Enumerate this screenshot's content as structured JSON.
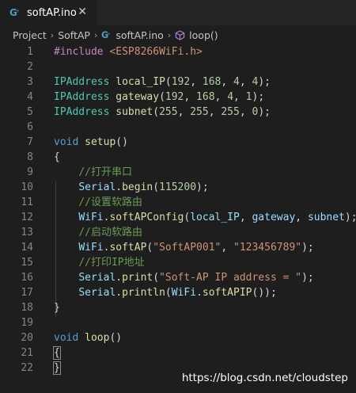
{
  "tab": {
    "filename": "softAP.ino",
    "close": "✕",
    "icon": "cpp-file-icon"
  },
  "breadcrumb": {
    "items": [
      "Project",
      "SoftAP",
      "softAP.ino",
      "loop()"
    ],
    "separator": "›"
  },
  "lines": [
    {
      "n": "1",
      "tokens": [
        [
          "#include ",
          "t-pre"
        ],
        [
          "<ESP8266WiFi.h>",
          "t-str"
        ]
      ]
    },
    {
      "n": "2",
      "tokens": []
    },
    {
      "n": "3",
      "tokens": [
        [
          "IPAddress ",
          "t-type"
        ],
        [
          "local_IP",
          "t-fn"
        ],
        [
          "(",
          "t-pun"
        ],
        [
          "192",
          "t-num"
        ],
        [
          ", ",
          "t-pun"
        ],
        [
          "168",
          "t-num"
        ],
        [
          ", ",
          "t-pun"
        ],
        [
          "4",
          "t-num"
        ],
        [
          ", ",
          "t-pun"
        ],
        [
          "4",
          "t-num"
        ],
        [
          ");",
          "t-pun"
        ]
      ]
    },
    {
      "n": "4",
      "tokens": [
        [
          "IPAddress ",
          "t-type"
        ],
        [
          "gateway",
          "t-fn"
        ],
        [
          "(",
          "t-pun"
        ],
        [
          "192",
          "t-num"
        ],
        [
          ", ",
          "t-pun"
        ],
        [
          "168",
          "t-num"
        ],
        [
          ", ",
          "t-pun"
        ],
        [
          "4",
          "t-num"
        ],
        [
          ", ",
          "t-pun"
        ],
        [
          "1",
          "t-num"
        ],
        [
          ");",
          "t-pun"
        ]
      ]
    },
    {
      "n": "5",
      "tokens": [
        [
          "IPAddress ",
          "t-type"
        ],
        [
          "subnet",
          "t-fn"
        ],
        [
          "(",
          "t-pun"
        ],
        [
          "255",
          "t-num"
        ],
        [
          ", ",
          "t-pun"
        ],
        [
          "255",
          "t-num"
        ],
        [
          ", ",
          "t-pun"
        ],
        [
          "255",
          "t-num"
        ],
        [
          ", ",
          "t-pun"
        ],
        [
          "0",
          "t-num"
        ],
        [
          ");",
          "t-pun"
        ]
      ]
    },
    {
      "n": "6",
      "tokens": []
    },
    {
      "n": "7",
      "tokens": [
        [
          "void ",
          "t-kw"
        ],
        [
          "setup",
          "t-fn"
        ],
        [
          "()",
          "t-pun"
        ]
      ]
    },
    {
      "n": "8",
      "tokens": [
        [
          "{",
          "t-pun"
        ]
      ]
    },
    {
      "n": "9",
      "tokens": [
        [
          "    ",
          "t-pun"
        ],
        [
          "//打开串口",
          "t-com"
        ]
      ]
    },
    {
      "n": "10",
      "tokens": [
        [
          "    ",
          "t-pun"
        ],
        [
          "Serial",
          "t-var"
        ],
        [
          ".",
          "t-pun"
        ],
        [
          "begin",
          "t-fn"
        ],
        [
          "(",
          "t-pun"
        ],
        [
          "115200",
          "t-num"
        ],
        [
          ");",
          "t-pun"
        ]
      ]
    },
    {
      "n": "11",
      "tokens": [
        [
          "    ",
          "t-pun"
        ],
        [
          "//设置软路由",
          "t-com"
        ]
      ]
    },
    {
      "n": "12",
      "tokens": [
        [
          "    ",
          "t-pun"
        ],
        [
          "WiFi",
          "t-var"
        ],
        [
          ".",
          "t-pun"
        ],
        [
          "softAPConfig",
          "t-fn"
        ],
        [
          "(",
          "t-pun"
        ],
        [
          "local_IP",
          "t-var"
        ],
        [
          ", ",
          "t-pun"
        ],
        [
          "gateway",
          "t-var"
        ],
        [
          ", ",
          "t-pun"
        ],
        [
          "subnet",
          "t-var"
        ],
        [
          ");",
          "t-pun"
        ]
      ]
    },
    {
      "n": "13",
      "tokens": [
        [
          "    ",
          "t-pun"
        ],
        [
          "//启动软路由",
          "t-com"
        ]
      ]
    },
    {
      "n": "14",
      "tokens": [
        [
          "    ",
          "t-pun"
        ],
        [
          "WiFi",
          "t-var"
        ],
        [
          ".",
          "t-pun"
        ],
        [
          "softAP",
          "t-fn"
        ],
        [
          "(",
          "t-pun"
        ],
        [
          "\"SoftAP001\"",
          "t-str"
        ],
        [
          ", ",
          "t-pun"
        ],
        [
          "\"123456789\"",
          "t-str"
        ],
        [
          ");",
          "t-pun"
        ]
      ]
    },
    {
      "n": "15",
      "tokens": [
        [
          "    ",
          "t-pun"
        ],
        [
          "//打印IP地址",
          "t-com"
        ]
      ]
    },
    {
      "n": "16",
      "tokens": [
        [
          "    ",
          "t-pun"
        ],
        [
          "Serial",
          "t-var"
        ],
        [
          ".",
          "t-pun"
        ],
        [
          "print",
          "t-fn"
        ],
        [
          "(",
          "t-pun"
        ],
        [
          "\"Soft-AP IP address = \"",
          "t-str"
        ],
        [
          ");",
          "t-pun"
        ]
      ]
    },
    {
      "n": "17",
      "tokens": [
        [
          "    ",
          "t-pun"
        ],
        [
          "Serial",
          "t-var"
        ],
        [
          ".",
          "t-pun"
        ],
        [
          "println",
          "t-fn"
        ],
        [
          "(",
          "t-pun"
        ],
        [
          "WiFi",
          "t-var"
        ],
        [
          ".",
          "t-pun"
        ],
        [
          "softAPIP",
          "t-fn"
        ],
        [
          "());",
          "t-pun"
        ]
      ]
    },
    {
      "n": "18",
      "tokens": [
        [
          "}",
          "t-pun"
        ]
      ]
    },
    {
      "n": "19",
      "tokens": []
    },
    {
      "n": "20",
      "tokens": [
        [
          "void ",
          "t-kw"
        ],
        [
          "loop",
          "t-fn"
        ],
        [
          "()",
          "t-pun"
        ]
      ]
    },
    {
      "n": "21",
      "tokens": [
        [
          "{",
          "t-pun"
        ]
      ]
    },
    {
      "n": "22",
      "tokens": [
        [
          "}",
          "t-pun"
        ]
      ]
    }
  ],
  "watermark": "https://blog.csdn.net/cloudstep",
  "colors": {
    "background": "#1e1e1e",
    "keyword": "#569cd6",
    "type": "#4ec9b0",
    "function": "#dcdcaa",
    "string": "#ce9178",
    "number": "#b5cea8",
    "comment": "#6a9955",
    "preprocessor": "#c586c0"
  }
}
